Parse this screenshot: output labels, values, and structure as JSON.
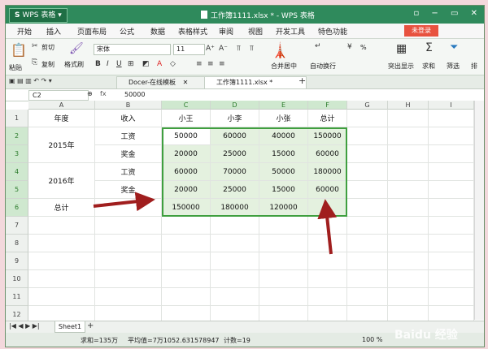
{
  "app": {
    "name": "WPS 表格",
    "window_title": "工作簿1111.xlsx * - WPS 表格"
  },
  "menu": [
    "开始",
    "插入",
    "页面布局",
    "公式",
    "数据",
    "表格样式",
    "审阅",
    "视图",
    "开发工具",
    "特色功能"
  ],
  "login_label": "未登录",
  "ribbon": {
    "paste": "粘贴",
    "cut": "剪切",
    "copy": "复制",
    "format_painter": "格式刷",
    "font_name": "宋体",
    "font_size": "11",
    "merge_center": "合并居中",
    "wrap_text": "自动换行",
    "percent_label": "%",
    "highlight": "突出显示",
    "sum": "求和",
    "filter": "筛选",
    "sort": "排"
  },
  "doc_tabs": [
    {
      "label": "Docer-在线模板",
      "active": false
    },
    {
      "label": "工作簿1111.xlsx *",
      "active": true
    }
  ],
  "formula_bar": {
    "name_box": "C2",
    "fx_label": "fx",
    "value": "50000"
  },
  "columns": [
    "A",
    "B",
    "C",
    "D",
    "E",
    "F",
    "G",
    "H",
    "I"
  ],
  "rows": [
    "1",
    "2",
    "3",
    "4",
    "5",
    "6",
    "7",
    "8",
    "9",
    "10",
    "11",
    "12",
    "13"
  ],
  "table": {
    "header": [
      "年度",
      "收入",
      "小王",
      "小李",
      "小张",
      "总计"
    ],
    "years": [
      "2015年",
      "2016年"
    ],
    "total_label": "总计",
    "income_types": [
      "工资",
      "奖金",
      "工资",
      "奖金"
    ],
    "values": [
      [
        "50000",
        "60000",
        "40000",
        "150000"
      ],
      [
        "20000",
        "25000",
        "15000",
        "60000"
      ],
      [
        "60000",
        "70000",
        "50000",
        "180000"
      ],
      [
        "20000",
        "25000",
        "15000",
        "60000"
      ],
      [
        "150000",
        "180000",
        "120000",
        ""
      ]
    ]
  },
  "sheet_tab": "Sheet1",
  "status": {
    "sum_text": "求和=135万",
    "avg_text": "平均值=7万1052.631578947",
    "count_text": "计数=19",
    "zoom": "100 %"
  },
  "colors": {
    "title_green": "#2f8a5c",
    "selection_border": "#3f9f3f",
    "data_fill": "#e4f1df",
    "arrow_red": "#a01e1e",
    "login_red": "#e8523f"
  },
  "watermark": "Baidu 经验"
}
